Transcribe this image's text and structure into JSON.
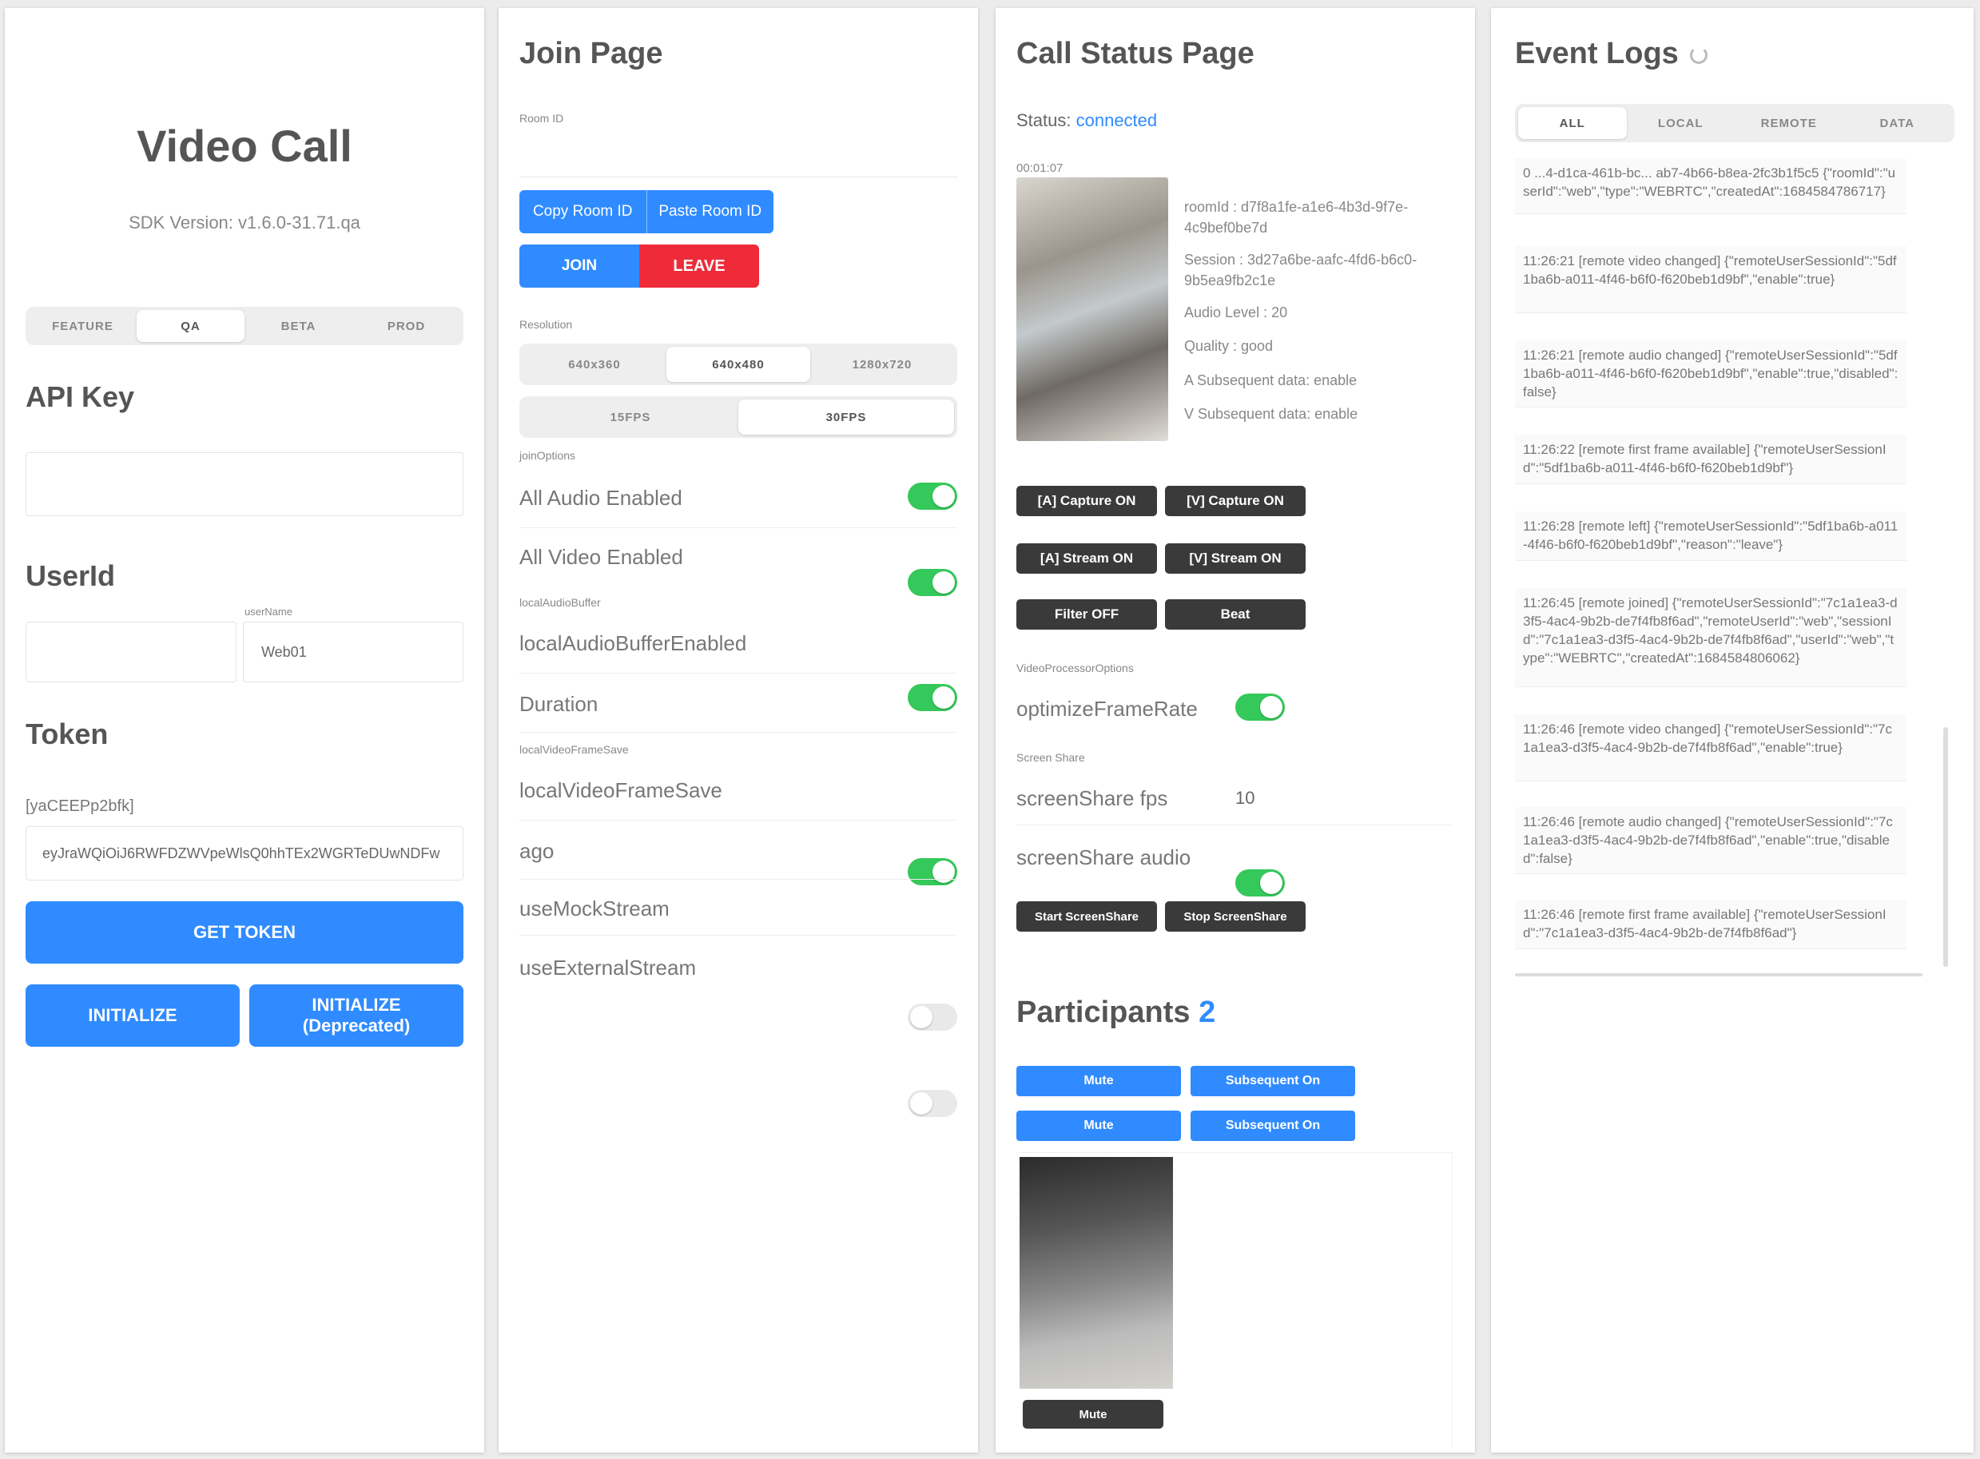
{
  "home": {
    "title": "Video Call",
    "sdk_version": "SDK Version: v1.6.0-31.71.qa",
    "env_tabs": [
      "FEATURE",
      "QA",
      "BETA",
      "PROD"
    ],
    "api_key_label": "API Key",
    "api_key_value": "",
    "userid_label": "UserId",
    "userid_value": "",
    "user_name_caption": "userName",
    "user_name_value": "Web01",
    "token_label": "Token",
    "token_caption": "[yaCEEPp2bfk]",
    "token_value": "eyJraWQiOiJ6RWFDZWVpeWlsQ0hhTEx2WGRTeDUwNDFw",
    "get_token_button": "GET TOKEN",
    "initialize_button": "INITIALIZE",
    "initialize_deprecated_button": "INITIALIZE (Deprecated)"
  },
  "join": {
    "title": "Join Page",
    "room_id_label": "Room ID",
    "room_id_value": "",
    "copy_room_button": "Copy Room ID",
    "paste_room_button": "Paste Room ID",
    "join_button": "JOIN",
    "leave_button": "LEAVE",
    "resolution_label": "Resolution",
    "resolution_options": [
      "640x360",
      "640x480",
      "1280x720"
    ],
    "fps_options": [
      "15FPS",
      "30FPS"
    ],
    "join_options_label": "joinOptions",
    "all_audio_label": "All Audio Enabled",
    "all_video_label": "All Video Enabled",
    "local_audio_buffer_caption": "localAudioBuffer",
    "local_audio_buffer_label": "localAudioBufferEnabled",
    "duration_label": "Duration",
    "local_video_frame_caption": "localVideoFrameSave",
    "local_video_frame_label": "localVideoFrameSave",
    "ago_label": "ago",
    "mock_stream_label": "useMockStream",
    "external_stream_label": "useExternalStream"
  },
  "status": {
    "title": "Call Status Page",
    "status_prefix": "Status:",
    "status_value": "connected",
    "timer": "00:01:07",
    "info_lines": [
      "roomId : d7f8a1fe-a1e6-4b3d-9f7e-4c9bef0be7d",
      "Session : 3d27a6be-aafc-4fd6-b6c0-9b5ea9fb2c1e",
      "Audio Level : 20",
      "Quality : good",
      "A Subsequent data: enable",
      "V Subsequent data: enable"
    ],
    "dark_buttons": [
      [
        "[A] Capture ON",
        "[V] Capture ON"
      ],
      [
        "[A] Stream ON",
        "[V] Stream ON"
      ],
      [
        "Filter OFF",
        "Beat"
      ]
    ],
    "video_processor_caption": "VideoProcessorOptions",
    "optimize_label": "optimizeFrameRate",
    "screen_share_caption": "Screen Share",
    "screen_fps_label": "screenShare fps",
    "screen_fps_value": "10",
    "screen_audio_label": "screenShare audio",
    "screen_buttons": [
      "Start ScreenShare",
      "Stop ScreenShare"
    ],
    "participants_label": "Participants",
    "participants_count": "2",
    "participant_buttons": [
      [
        "Mute",
        "Subsequent On"
      ],
      [
        "Mute",
        "Subsequent On"
      ]
    ],
    "remote_button": "Mute"
  },
  "logs": {
    "title": "Event Logs",
    "tabs": [
      "ALL",
      "LOCAL",
      "REMOTE",
      "DATA"
    ],
    "entries": [
      "0 ...4-d1ca-461b-bc... ab7-4b66-b8ea-2fc3b1f5c5 {\"roomId\":\"userId\":\"web\",\"type\":\"WEBRTC\",\"createdAt\":1684584786717}",
      "11:26:21 [remote video changed] {\"remoteUserSessionId\":\"5df1ba6b-a011-4f46-b6f0-f620beb1d9bf\",\"enable\":true}",
      "11:26:21 [remote audio changed] {\"remoteUserSessionId\":\"5df1ba6b-a011-4f46-b6f0-f620beb1d9bf\",\"enable\":true,\"disabled\":false}",
      "11:26:22 [remote first frame available] {\"remoteUserSessionId\":\"5df1ba6b-a011-4f46-b6f0-f620beb1d9bf\"}",
      "11:26:28 [remote left] {\"remoteUserSessionId\":\"5df1ba6b-a011-4f46-b6f0-f620beb1d9bf\",\"reason\":\"leave\"}",
      "11:26:45 [remote joined] {\"remoteUserSessionId\":\"7c1a1ea3-d3f5-4ac4-9b2b-de7f4fb8f6ad\",\"remoteUserId\":\"web\",\"sessionId\":\"7c1a1ea3-d3f5-4ac4-9b2b-de7f4fb8f6ad\",\"userId\":\"web\",\"type\":\"WEBRTC\",\"createdAt\":1684584806062}",
      "11:26:46 [remote video changed] {\"remoteUserSessionId\":\"7c1a1ea3-d3f5-4ac4-9b2b-de7f4fb8f6ad\",\"enable\":true}",
      "11:26:46 [remote audio changed] {\"remoteUserSessionId\":\"7c1a1ea3-d3f5-4ac4-9b2b-de7f4fb8f6ad\",\"enable\":true,\"disabled\":false}",
      "11:26:46 [remote first frame available] {\"remoteUserSessionId\":\"7c1a1ea3-d3f5-4ac4-9b2b-de7f4fb8f6ad\"}"
    ]
  }
}
